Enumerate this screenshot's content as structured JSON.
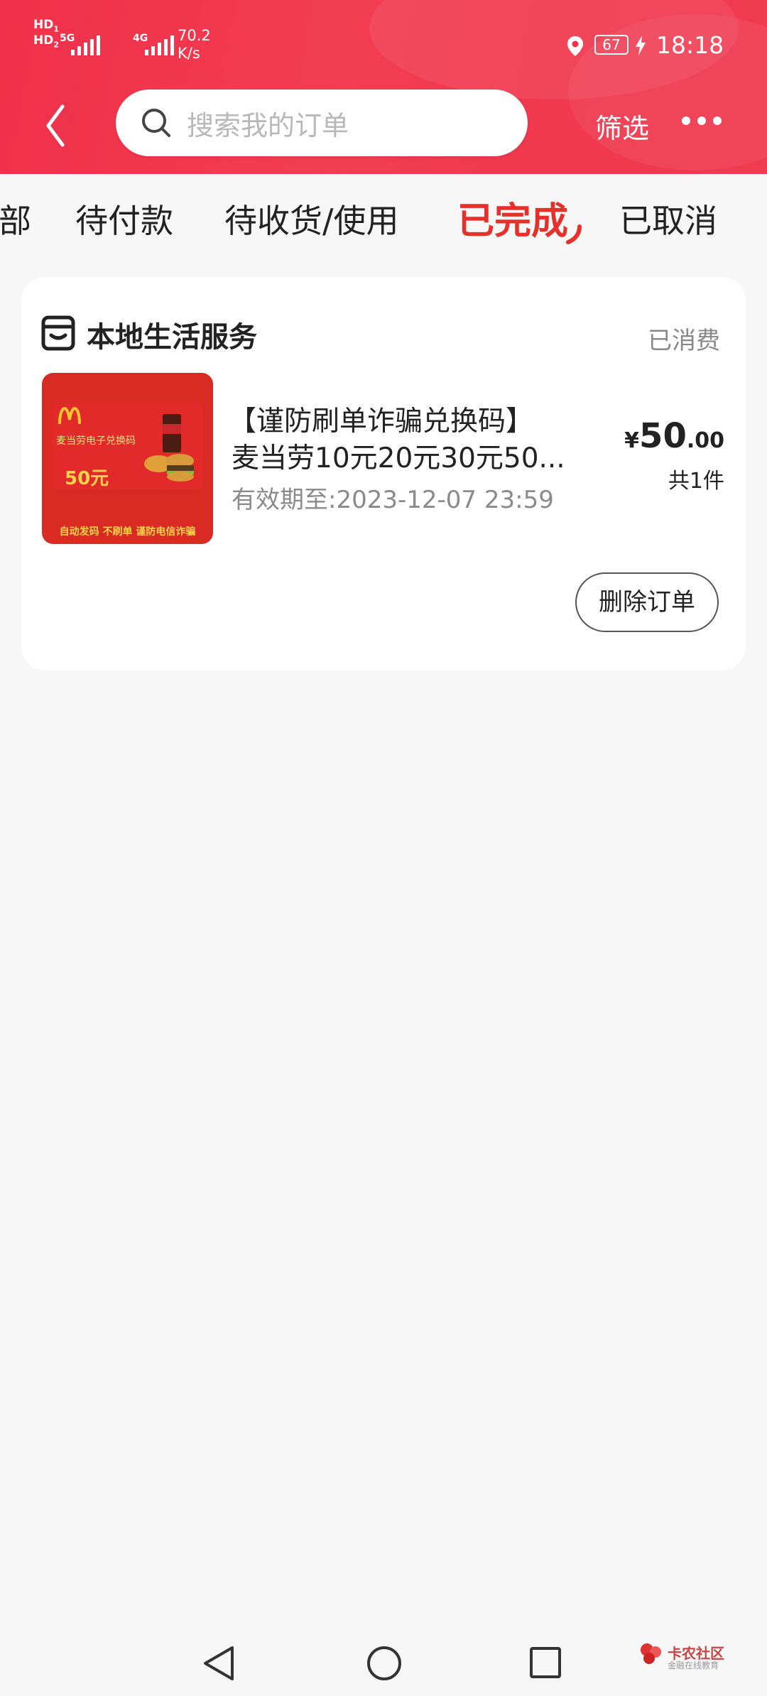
{
  "status_bar": {
    "hd1": "HD",
    "hd1_sub": "1",
    "hd2": "HD",
    "hd2_sub": "2",
    "net1": "5G",
    "net2": "4G",
    "speed_value": "70.2",
    "speed_unit": "K/s",
    "battery": "67",
    "time": "18:18"
  },
  "nav": {
    "search_placeholder": "搜索我的订单",
    "filter_label": "筛选"
  },
  "tabs": [
    {
      "label": "部",
      "active": false
    },
    {
      "label": "待付款",
      "active": false
    },
    {
      "label": "待收货/使用",
      "active": false
    },
    {
      "label": "已完成",
      "active": true
    },
    {
      "label": "已取消",
      "active": false
    }
  ],
  "order": {
    "store_name": "本地生活服务",
    "status": "已消费",
    "thumbnail": {
      "caption": "麦当劳电子兑换码",
      "amount": "50元",
      "footer": "自动发码 不刷单 谨防电信诈骗"
    },
    "title_line1": "【谨防刷单诈骗兑换码】",
    "title_line2": "麦当劳10元20元30元50...",
    "validity": "有效期至:2023-12-07 23:59",
    "price_currency": "¥",
    "price_int": "50",
    "price_dec": ".00",
    "quantity": "共1件",
    "delete_button": "删除订单"
  },
  "watermark": {
    "name": "卡农社区",
    "sub": "金融在线教育"
  },
  "colors": {
    "header_red": "#f0304a",
    "active_tab": "#e8302a",
    "background": "#f7f7f7"
  }
}
